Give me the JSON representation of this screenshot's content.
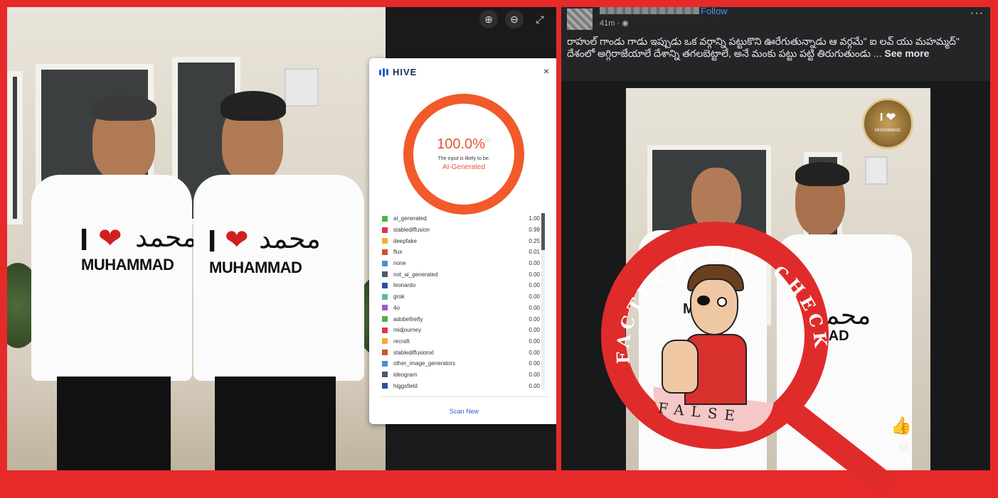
{
  "colors": {
    "frame_red": "#e62a2a",
    "hive_ring": "#f15a2b",
    "fb_link": "#4b8ef0"
  },
  "left_photo": {
    "tee_left": {
      "i": "I",
      "word": "MUHAMMAD",
      "arabic": "محمد"
    },
    "tee_right": {
      "i": "I",
      "word": "MUHAMMAD",
      "arabic": "محمد"
    }
  },
  "viewer": {
    "icons": [
      "zoom-in-icon",
      "zoom-out-icon",
      "expand-icon"
    ],
    "zoom_in": "⊕",
    "zoom_out": "⊖",
    "expand": "⤢"
  },
  "hive": {
    "title": "HIVE",
    "close": "×",
    "percent": "100.0%",
    "info": "ⓘ",
    "subtitle": "The input is likely to be:",
    "verdict": "AI-Generated",
    "rows": [
      {
        "name": "ai_generated",
        "value": "1.00",
        "color": "#44b840"
      },
      {
        "name": "stablediffusion",
        "value": "0.99",
        "color": "#e03150"
      },
      {
        "name": "deepfake",
        "value": "0.25",
        "color": "#f0b032"
      },
      {
        "name": "flux",
        "value": "0.01",
        "color": "#d2502e"
      },
      {
        "name": "none",
        "value": "0.00",
        "color": "#4a8fd0"
      },
      {
        "name": "not_ai_generated",
        "value": "0.00",
        "color": "#4f5a66"
      },
      {
        "name": "leonardo",
        "value": "0.00",
        "color": "#2c4fa0"
      },
      {
        "name": "grok",
        "value": "0.00",
        "color": "#5bb8a8"
      },
      {
        "name": "4o",
        "value": "0.00",
        "color": "#9a5bc8"
      },
      {
        "name": "adobefirefly",
        "value": "0.00",
        "color": "#44b840"
      },
      {
        "name": "midjourney",
        "value": "0.00",
        "color": "#e03150"
      },
      {
        "name": "recraft",
        "value": "0.00",
        "color": "#f0b032"
      },
      {
        "name": "stablediffusionxl",
        "value": "0.00",
        "color": "#d2502e"
      },
      {
        "name": "other_image_generators",
        "value": "0.00",
        "color": "#4a8fd0"
      },
      {
        "name": "ideogram",
        "value": "0.00",
        "color": "#4f5a66"
      },
      {
        "name": "higgsfield",
        "value": "0.00",
        "color": "#2c4fa0"
      }
    ],
    "scan_new": "Scan New"
  },
  "post": {
    "follow": "Follow",
    "time": "41m · ◉",
    "more": "···",
    "caption_line1": "రాహుల్ గాండు గాడు ఇప్పుడు ఒక వర్గాన్ని పట్టుకొని ఊరేగుతున్నాడు ఆ వర్గమే\" ఐ లవ్ యు మహమ్మద్\"",
    "caption_line2": "దేశంలో అగ్గిరాజేయాలే దేశాన్ని తగలబెట్టాలే, అనే మంకు పట్టు పట్టి తిరుగుతుండు ...",
    "see_more": "See more",
    "like_count": "66",
    "tee_left_word": "MU",
    "tee_right_word": "MAD",
    "badge_i": "I ❤",
    "badge_text": "MUHAMMAD"
  },
  "stamp": {
    "arc_text": "FACTLY FACT - CHECK",
    "false_label": "FALSE"
  }
}
